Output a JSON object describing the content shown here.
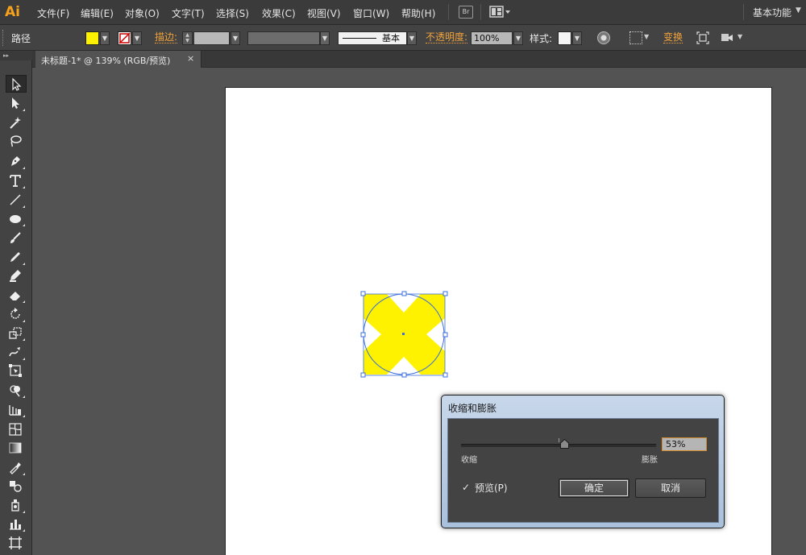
{
  "app": {
    "logo": "Ai"
  },
  "menubar": {
    "items": [
      "文件(F)",
      "编辑(E)",
      "对象(O)",
      "文字(T)",
      "选择(S)",
      "效果(C)",
      "视图(V)",
      "窗口(W)",
      "帮助(H)"
    ],
    "bridge_label": "Br",
    "workspace_label": "基本功能",
    "workspace_caret": "▼"
  },
  "controlbar": {
    "object_type": "路径",
    "fill_color": "#fff200",
    "stroke_label": "描边:",
    "brush_label": "基本",
    "opacity_label": "不透明度:",
    "opacity_value": "100%",
    "style_label": "样式:",
    "transform_label": "变换",
    "caret": "▼"
  },
  "toolbox": {
    "header": "▸▸",
    "tools": [
      "selection-tool",
      "direct-selection-tool",
      "magic-wand-tool",
      "lasso-tool",
      "pen-tool",
      "type-tool",
      "line-segment-tool",
      "ellipse-tool",
      "paintbrush-tool",
      "pencil-tool",
      "blob-brush-tool",
      "eraser-tool",
      "rotate-tool",
      "scale-tool",
      "warp-tool",
      "free-transform-tool",
      "shape-builder-tool",
      "perspective-grid-tool",
      "mesh-tool",
      "gradient-tool",
      "eyedropper-tool",
      "blend-tool",
      "symbol-sprayer-tool",
      "column-graph-tool",
      "artboard-tool"
    ]
  },
  "document": {
    "tab_title": "未标题-1* @ 139% (RGB/预览)",
    "tab_close": "×"
  },
  "artwork": {
    "fill": "#fff200",
    "selection_color": "#3c6fd9"
  },
  "dialog": {
    "title": "收缩和膨胀",
    "value": "53%",
    "value_fraction": 0.53,
    "shrink_label": "收缩",
    "expand_label": "膨胀",
    "preview_checked": "✓",
    "preview_label": "预览(P)",
    "ok_label": "确定",
    "cancel_label": "取消"
  }
}
